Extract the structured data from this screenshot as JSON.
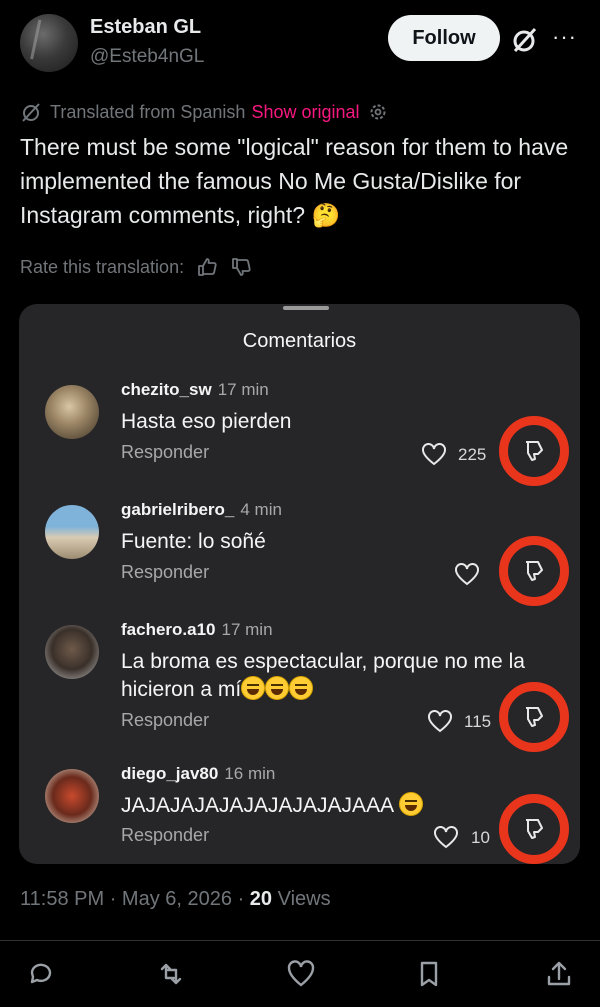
{
  "author": {
    "display_name": "Esteban GL",
    "handle": "@Esteb4nGL",
    "follow_label": "Follow",
    "more_glyph": "···"
  },
  "translation": {
    "label": "Translated from Spanish",
    "show_original": "Show original",
    "rate_label": "Rate this translation:"
  },
  "tweet": {
    "text": "There must be some \"logical\" reason for them to have implemented the famous No Me Gusta/Dislike for Instagram comments, right? 🤔"
  },
  "embed": {
    "title": "Comentarios",
    "comments": [
      {
        "user": "chezito_sw",
        "time": "17 min",
        "text": "Hasta eso pierden",
        "reply": "Responder",
        "likes": "225"
      },
      {
        "user": "gabrielribero_",
        "time": "4 min",
        "text": "Fuente: lo soñé",
        "reply": "Responder",
        "likes": ""
      },
      {
        "user": "fachero.a10",
        "time": "17 min",
        "text": "La broma es espectacular, porque no me la hicieron a mí",
        "reply": "Responder",
        "likes": "115"
      },
      {
        "user": "diego_jav80",
        "time": "16 min",
        "text": "JAJAJAJAJAJAJAJAJAJAAA",
        "reply": "Responder",
        "likes": "10"
      }
    ]
  },
  "meta": {
    "time": "11:58 PM",
    "date": "May 6, 2026",
    "sep": "·",
    "views_count": "20",
    "views_label": "Views"
  },
  "colors": {
    "accent_pink": "#f91880",
    "dislike_ring": "#e8351c",
    "background": "#000000",
    "panel": "#262628"
  },
  "icons": [
    "grok-icon",
    "more-icon",
    "translate-icon",
    "settings-icon",
    "thumbs-up-icon",
    "thumbs-down-icon",
    "heart-icon",
    "dislike-icon",
    "reply-icon",
    "retweet-icon",
    "like-icon",
    "bookmark-icon",
    "share-icon"
  ]
}
